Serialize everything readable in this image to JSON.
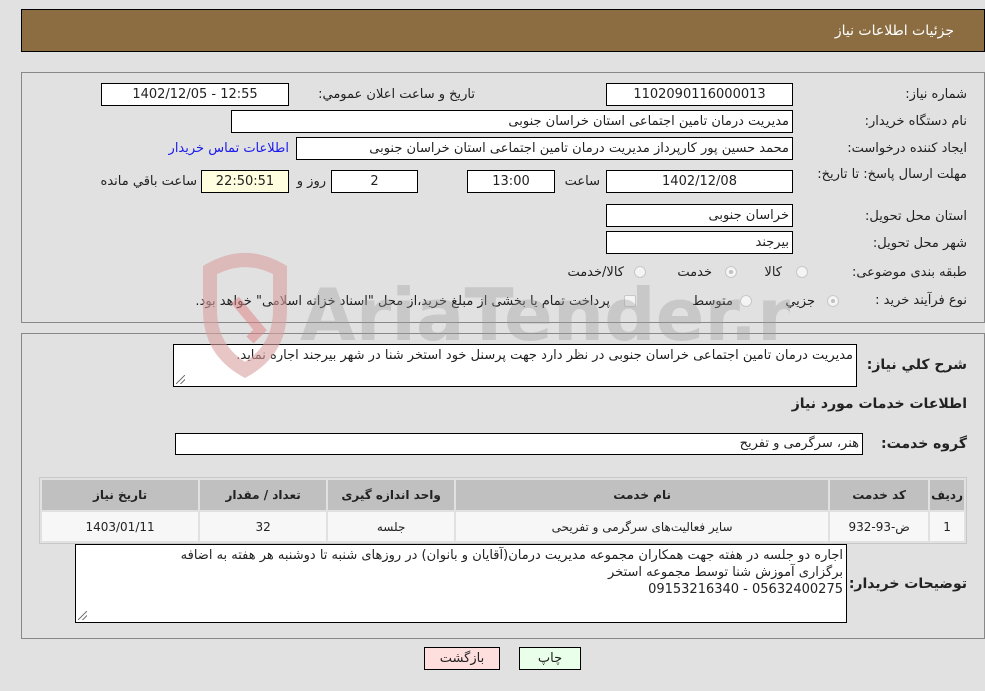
{
  "header": {
    "title": "جزئیات اطلاعات نیاز"
  },
  "form": {
    "need_number_label": "شماره نیاز:",
    "need_number": "1102090116000013",
    "announce_label": "تاریخ و ساعت اعلان عمومي:",
    "announce_value": "1402/12/05 - 12:55",
    "buyer_org_label": "نام دستگاه خريدار:",
    "buyer_org": "مدیریت درمان تامین اجتماعی استان خراسان جنوبی",
    "creator_label": "ايجاد کننده درخواست:",
    "creator": "محمد حسین پور کارپرداز مدیریت درمان تامین اجتماعی استان خراسان جنوبی",
    "buyer_contact_link": "اطلاعات تماس خريدار",
    "deadline_label": "مهلت ارسال پاسخ: تا تاريخ:",
    "deadline_date": "1402/12/08",
    "time_label": "ساعت",
    "deadline_time": "13:00",
    "days_value": "2",
    "days_label": "روز و",
    "remaining_time": "22:50:51",
    "remaining_label": "ساعت باقي مانده",
    "province_label": "استان محل تحويل:",
    "province": "خراسان جنوبی",
    "city_label": "شهر محل تحويل:",
    "city": "بیرجند",
    "category_label": "طبقه بندی موضوعی:",
    "category_options": [
      {
        "label": "کالا",
        "checked": false
      },
      {
        "label": "خدمت",
        "checked": true
      },
      {
        "label": "کالا/خدمت",
        "checked": false
      }
    ],
    "process_label": "نوع فرآيند خريد :",
    "process_options": [
      {
        "label": "جزيي",
        "checked": true
      },
      {
        "label": "متوسط",
        "checked": false
      }
    ],
    "treasury_checkbox_label": "پرداخت تمام يا بخشی از مبلغ خريد،از محل \"اسناد خزانه اسلامی\" خواهد بود.",
    "treasury_checked": false
  },
  "details": {
    "description_label": "شرح کلي نياز:",
    "description": "مدیریت درمان تامین اجتماعی خراسان جنوبی در نظر دارد جهت پرسنل خود استخر شنا در شهر بیرجند اجاره نماید.",
    "services_heading": "اطلاعات خدمات مورد نياز",
    "service_group_label": "گروه خدمت:",
    "service_group": "هنر، سرگرمی و تفریح",
    "table": {
      "headers": [
        "رديف",
        "کد خدمت",
        "نام خدمت",
        "واحد اندازه گيری",
        "تعداد / مقدار",
        "تاريخ نياز"
      ],
      "rows": [
        [
          "1",
          "ض-93-932",
          "سایر فعالیت‌های سرگرمی و تفریحی",
          "جلسه",
          "32",
          "1403/01/11"
        ]
      ]
    },
    "buyer_notes_label": "توضيحات خريدار:",
    "buyer_notes_lines": [
      "اجاره دو جلسه در هفته جهت همکاران مجموعه مدیریت درمان(آقایان و بانوان) در روزهای شنبه تا دوشنبه هر هفته به اضافه",
      "برگزاری آموزش شنا توسط مجموعه استخر",
      "05632400275 - 09153216340"
    ]
  },
  "buttons": {
    "print": "چاپ",
    "back": "بازگشت"
  },
  "colors": {
    "header": "#8c6d42",
    "print_bg": "#eaffea",
    "back_bg": "#ffdede",
    "remaining_bg": "#ffffe0",
    "link": "#1a1aee"
  }
}
